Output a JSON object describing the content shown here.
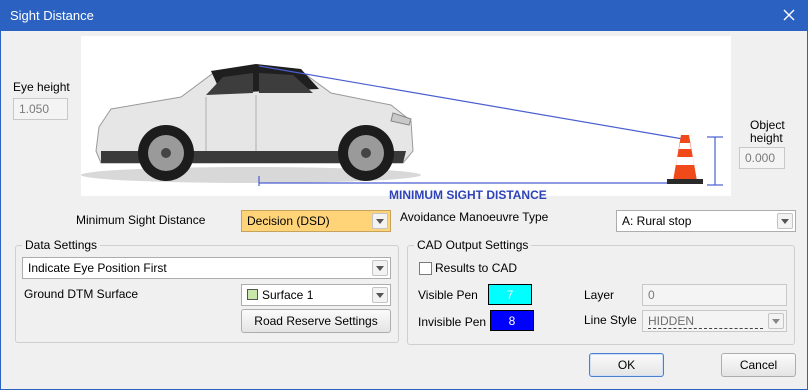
{
  "window": {
    "title": "Sight Distance",
    "close_icon": "close-icon"
  },
  "diagram": {
    "eye_height_label": "Eye height",
    "eye_height_value": "1.050",
    "object_height_label_line1": "Object",
    "object_height_label_line2": "height",
    "object_height_value": "0.000",
    "caption": "MINIMUM SIGHT DISTANCE",
    "line_color": "#4a5fd0"
  },
  "settings": {
    "min_sight_distance_label": "Minimum Sight Distance",
    "min_sight_distance_value": "Decision (DSD)",
    "avoidance_label": "Avoidance Manoeuvre Type",
    "avoidance_value": "A: Rural stop"
  },
  "data_settings": {
    "legend": "Data Settings",
    "eye_position_value": "Indicate Eye Position First",
    "ground_dtm_label": "Ground DTM Surface",
    "surface_value": "Surface 1",
    "surface_swatch_color": "#c9e7a8",
    "road_reserve_button": "Road Reserve Settings"
  },
  "cad_output": {
    "legend": "CAD Output Settings",
    "results_to_cad_label": "Results to CAD",
    "results_to_cad_checked": false,
    "visible_pen_label": "Visible Pen",
    "visible_pen_value": "7",
    "visible_pen_color": "#00ffff",
    "invisible_pen_label": "Invisible Pen",
    "invisible_pen_value": "8",
    "invisible_pen_color": "#0000ff",
    "layer_label": "Layer",
    "layer_value": "0",
    "line_style_label": "Line Style",
    "line_style_value": "HIDDEN"
  },
  "buttons": {
    "ok": "OK",
    "cancel": "Cancel"
  }
}
